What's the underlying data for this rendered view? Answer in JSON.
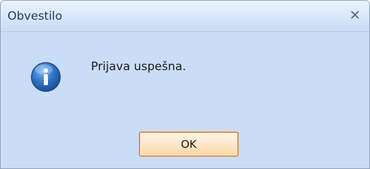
{
  "dialog": {
    "title": "Obvestilo",
    "close_glyph": "✕",
    "icon": "info-icon",
    "message": "Prijava uspešna.",
    "ok_label": "OK"
  },
  "colors": {
    "titlebar": "#d9e8fa",
    "client": "#c9ddf6",
    "icon_blue": "#2f74c8",
    "button_border": "#e38f3f"
  }
}
